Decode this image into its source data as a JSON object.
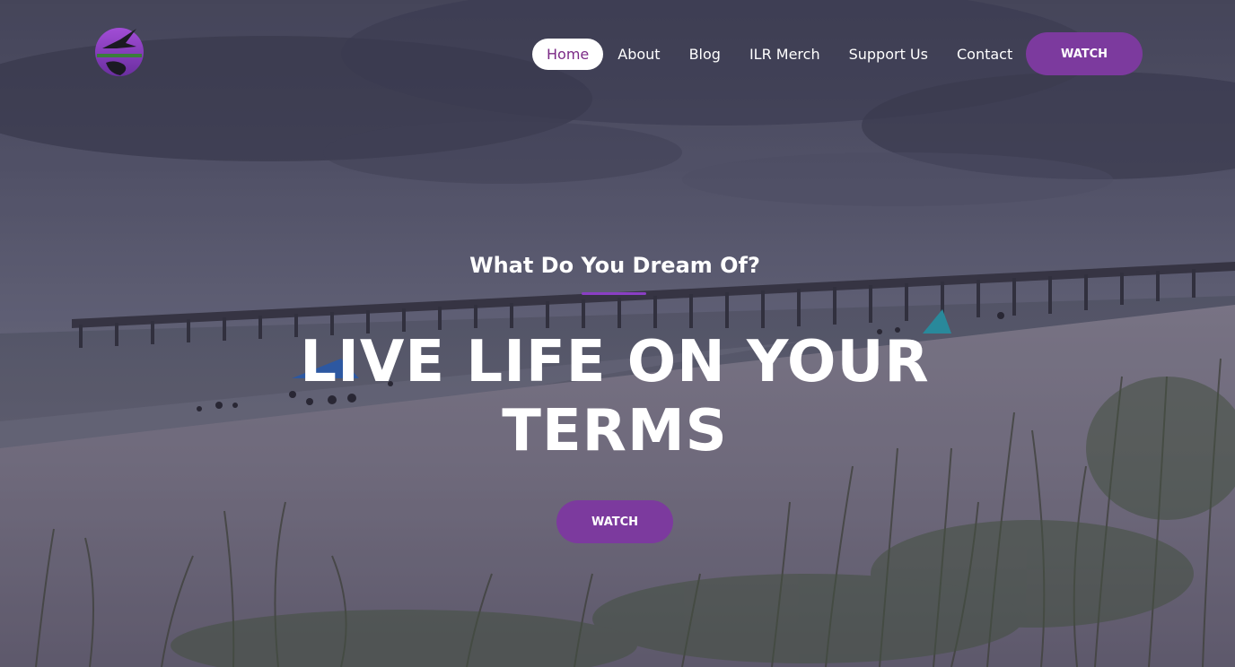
{
  "header": {
    "logo_name": "bird-globe-logo",
    "nav": [
      {
        "label": "Home",
        "active": true
      },
      {
        "label": "About",
        "active": false
      },
      {
        "label": "Blog",
        "active": false
      },
      {
        "label": "ILR Merch",
        "active": false
      },
      {
        "label": "Support Us",
        "active": false
      },
      {
        "label": "Contact",
        "active": false
      }
    ],
    "cta_label": "WATCH"
  },
  "hero": {
    "subtitle": "What Do You Dream Of?",
    "title_line1": "LIVE LIFE ON YOUR",
    "title_line2": "TERMS",
    "cta_label": "WATCH"
  },
  "colors": {
    "accent": "#7c3a9e",
    "nav_active_text": "#7b2a86",
    "underline": "#8a3fc4"
  }
}
